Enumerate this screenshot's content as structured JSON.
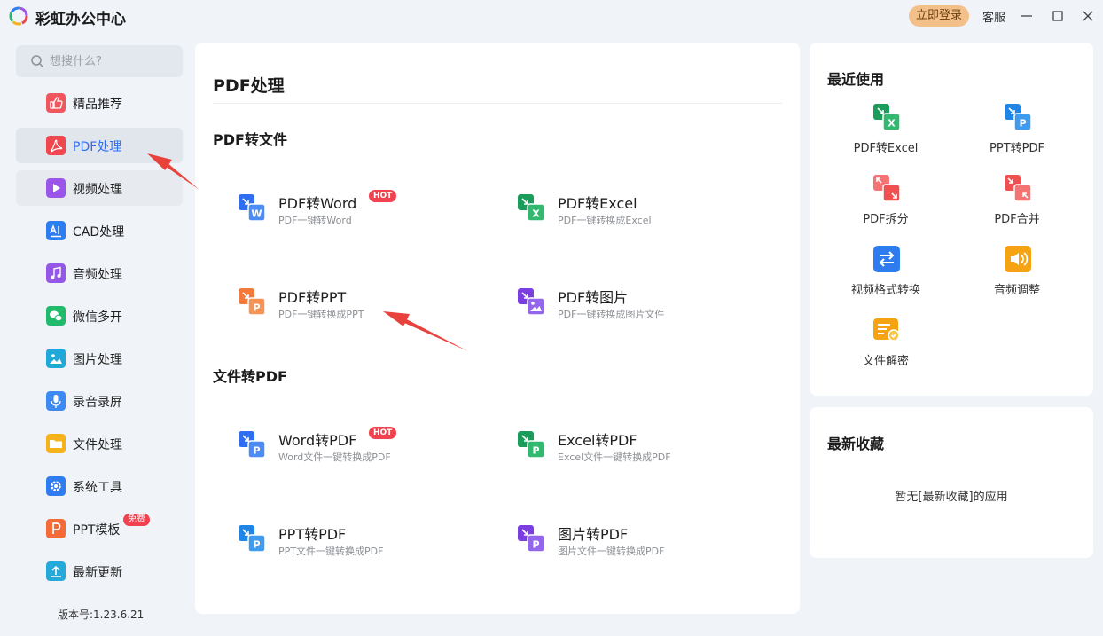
{
  "app": {
    "title": "彩虹办公中心",
    "login": "立即登录",
    "service": "客服"
  },
  "sidebar": {
    "search_placeholder": "想搜什么?",
    "items": [
      {
        "label": "精品推荐",
        "icon": "thumbs-up-icon",
        "color": "#f0565e"
      },
      {
        "label": "PDF处理",
        "icon": "pdf-icon",
        "color": "#f0474f"
      },
      {
        "label": "视频处理",
        "icon": "play-icon",
        "color": "#9b55e8"
      },
      {
        "label": "CAD处理",
        "icon": "cad-icon",
        "color": "#2d7cf0"
      },
      {
        "label": "音频处理",
        "icon": "music-icon",
        "color": "#9457e8"
      },
      {
        "label": "微信多开",
        "icon": "wechat-icon",
        "color": "#21b96a"
      },
      {
        "label": "图片处理",
        "icon": "image-icon",
        "color": "#1fa8d8"
      },
      {
        "label": "录音录屏",
        "icon": "microphone-icon",
        "color": "#3d8af2"
      },
      {
        "label": "文件处理",
        "icon": "folder-icon",
        "color": "#f5b21c"
      },
      {
        "label": "系统工具",
        "icon": "gear-icon",
        "color": "#2f7cf0"
      },
      {
        "label": "PPT模板",
        "icon": "ppt-icon",
        "color": "#f46b37",
        "badge": "免费"
      },
      {
        "label": "最新更新",
        "icon": "upload-icon",
        "color": "#25a9d9"
      }
    ],
    "version": "版本号:1.23.6.21"
  },
  "main": {
    "title": "PDF处理",
    "sections": [
      {
        "title": "PDF转文件",
        "tools": [
          {
            "name": "PDF转Word",
            "desc": "PDF一键转Word",
            "icon": "pdf-to-word-icon",
            "badge": "HOT"
          },
          {
            "name": "PDF转Excel",
            "desc": "PDF一键转换成Excel",
            "icon": "pdf-to-excel-icon"
          },
          {
            "name": "PDF转PPT",
            "desc": "PDF一键转换成PPT",
            "icon": "pdf-to-ppt-icon"
          },
          {
            "name": "PDF转图片",
            "desc": "PDF一键转换成图片文件",
            "icon": "pdf-to-image-icon"
          }
        ]
      },
      {
        "title": "文件转PDF",
        "tools": [
          {
            "name": "Word转PDF",
            "desc": "Word文件一键转换成PDF",
            "icon": "word-to-pdf-icon",
            "badge": "HOT"
          },
          {
            "name": "Excel转PDF",
            "desc": "Excel文件一键转换成PDF",
            "icon": "excel-to-pdf-icon"
          },
          {
            "name": "PPT转PDF",
            "desc": "PPT文件一键转换成PDF",
            "icon": "ppt-to-pdf-icon"
          },
          {
            "name": "图片转PDF",
            "desc": "图片文件一键转换成PDF",
            "icon": "image-to-pdf-icon"
          }
        ]
      }
    ]
  },
  "recent": {
    "title": "最近使用",
    "items": [
      {
        "label": "PDF转Excel",
        "icon": "pdf-to-excel-icon"
      },
      {
        "label": "PPT转PDF",
        "icon": "ppt-to-pdf-icon"
      },
      {
        "label": "PDF拆分",
        "icon": "pdf-split-icon"
      },
      {
        "label": "PDF合并",
        "icon": "pdf-merge-icon"
      },
      {
        "label": "视频格式转换",
        "icon": "video-convert-icon"
      },
      {
        "label": "音频调整",
        "icon": "audio-adjust-icon"
      },
      {
        "label": "文件解密",
        "icon": "file-decrypt-icon"
      }
    ]
  },
  "favorites": {
    "title": "最新收藏",
    "empty": "暂无[最新收藏]的应用"
  },
  "colors": {
    "accent": "#2f6ef0",
    "hot": "#f0434f",
    "login_bg": "#f3c089"
  }
}
